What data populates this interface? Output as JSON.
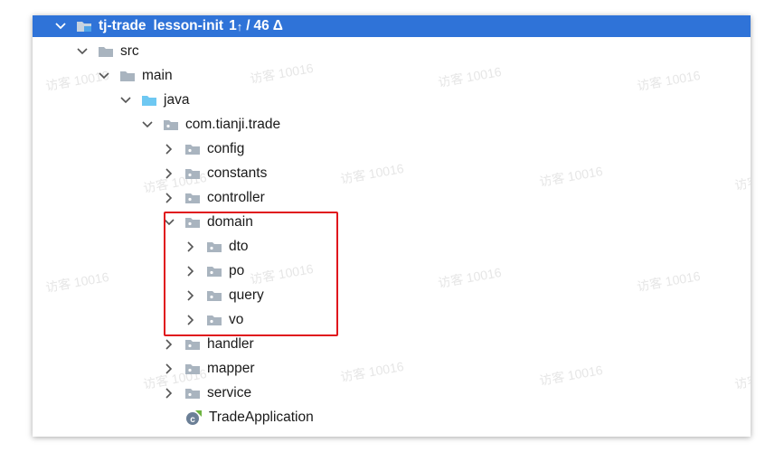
{
  "project": {
    "name": "tj-trade",
    "branch": "lesson-init",
    "ahead": "1",
    "changes": "46"
  },
  "tree": [
    {
      "label": "src",
      "type": "folder-plain",
      "expanded": true
    },
    {
      "label": "main",
      "type": "folder-plain",
      "expanded": true
    },
    {
      "label": "java",
      "type": "folder-source",
      "expanded": true
    },
    {
      "label": "com.tianji.trade",
      "type": "package",
      "expanded": true
    },
    {
      "label": "config",
      "type": "package",
      "expanded": false
    },
    {
      "label": "constants",
      "type": "package",
      "expanded": false
    },
    {
      "label": "controller",
      "type": "package",
      "expanded": false
    },
    {
      "label": "domain",
      "type": "package",
      "expanded": true
    },
    {
      "label": "dto",
      "type": "package",
      "expanded": false
    },
    {
      "label": "po",
      "type": "package",
      "expanded": false
    },
    {
      "label": "query",
      "type": "package",
      "expanded": false
    },
    {
      "label": "vo",
      "type": "package",
      "expanded": false
    },
    {
      "label": "handler",
      "type": "package",
      "expanded": false
    },
    {
      "label": "mapper",
      "type": "package",
      "expanded": false
    },
    {
      "label": "service",
      "type": "package",
      "expanded": false
    },
    {
      "label": "TradeApplication",
      "type": "spring-class",
      "expanded": null
    }
  ],
  "watermark_text": "访客 10016",
  "colors": {
    "selection": "#2f73d8",
    "highlight": "#e0161d",
    "folder": "#9aa7b4",
    "source_folder": "#6ec8f2",
    "spring": "#6db33f"
  }
}
